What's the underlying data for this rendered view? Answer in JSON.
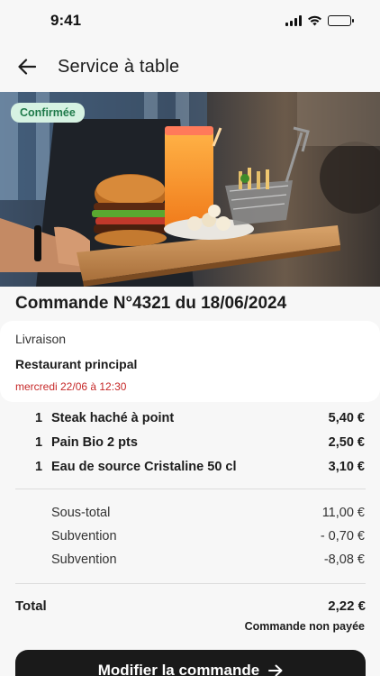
{
  "status_bar": {
    "time": "9:41"
  },
  "header": {
    "title": "Service à table"
  },
  "hero": {
    "badge": "Confirmée"
  },
  "order": {
    "title": "Commande N°4321 du 18/06/2024"
  },
  "delivery": {
    "type": "Livraison",
    "place": "Restaurant principal",
    "date": "mercredi 22/06 à 12:30"
  },
  "items": [
    {
      "qty": "1",
      "name": "Steak haché à point",
      "price": "5,40 €"
    },
    {
      "qty": "1",
      "name": "Pain Bio 2 pts",
      "price": "2,50 €"
    },
    {
      "qty": "1",
      "name": "Eau de source Cristaline 50 cl",
      "price": "3,10 €"
    }
  ],
  "summary": [
    {
      "label": "Sous-total",
      "value": "11,00 €"
    },
    {
      "label": "Subvention",
      "value": "- 0,70 €"
    },
    {
      "label": "Subvention",
      "value": "-8,08 €"
    }
  ],
  "total": {
    "label": "Total",
    "value": "2,22 €"
  },
  "payment_status": "Commande non payée",
  "cta": {
    "label": "Modifier la commande"
  },
  "colors": {
    "badge_bg": "#d6f2e2",
    "badge_text": "#1f7a4a",
    "date_red": "#c62828",
    "cta_bg": "#1a1a1a"
  }
}
